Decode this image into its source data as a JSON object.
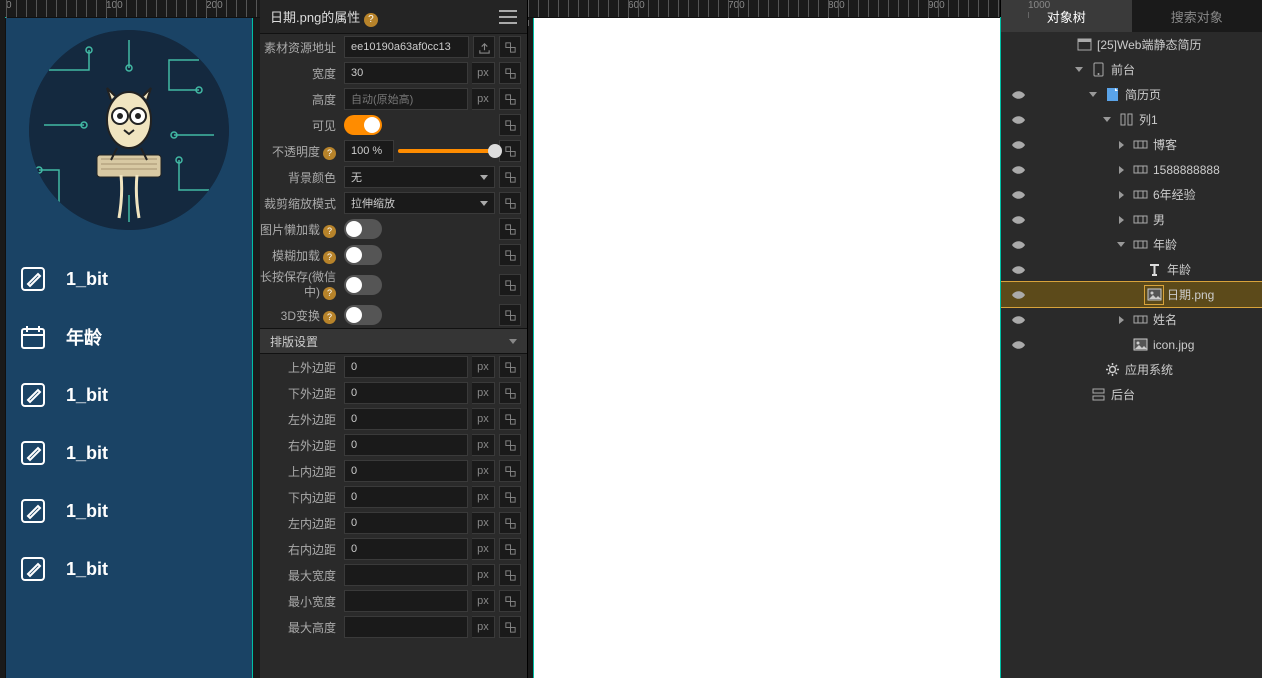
{
  "left_preview": {
    "items": [
      {
        "icon": "pencil",
        "label": "1_bit"
      },
      {
        "icon": "calendar",
        "label": "年龄"
      },
      {
        "icon": "pencil",
        "label": "1_bit"
      },
      {
        "icon": "pencil",
        "label": "1_bit"
      },
      {
        "icon": "pencil",
        "label": "1_bit"
      },
      {
        "icon": "pencil",
        "label": "1_bit"
      }
    ]
  },
  "prop_panel": {
    "title": "日期.png的属性",
    "fields": {
      "asset_url_label": "素材资源地址",
      "asset_url_value": "ee10190a63af0cc13",
      "width_label": "宽度",
      "width_value": "30",
      "px": "px",
      "height_label": "高度",
      "height_value": "自动(原始高)",
      "visible_label": "可见",
      "opacity_label": "不透明度",
      "opacity_value": "100 %",
      "opacity_pct": 100,
      "bgcolor_label": "背景颜色",
      "bgcolor_value": "无",
      "scale_label": "裁剪缩放模式",
      "scale_value": "拉伸缩放",
      "lazy_label": "图片懒加载",
      "blur_label": "模糊加载",
      "longpress_label": "长按保存(微信中)",
      "threed_label": "3D变换"
    },
    "layout_section": "排版设置",
    "layout": [
      {
        "k": "上外边距",
        "v": "0"
      },
      {
        "k": "下外边距",
        "v": "0"
      },
      {
        "k": "左外边距",
        "v": "0"
      },
      {
        "k": "右外边距",
        "v": "0"
      },
      {
        "k": "上内边距",
        "v": "0"
      },
      {
        "k": "下内边距",
        "v": "0"
      },
      {
        "k": "左内边距",
        "v": "0"
      },
      {
        "k": "右内边距",
        "v": "0"
      },
      {
        "k": "最大宽度",
        "v": ""
      },
      {
        "k": "最小宽度",
        "v": ""
      },
      {
        "k": "最大高度",
        "v": ""
      }
    ]
  },
  "ruler_left": [
    "0",
    "100",
    "200"
  ],
  "ruler_mid": [
    "",
    "600",
    "700",
    "800",
    "900",
    "1000"
  ],
  "obj_panel": {
    "tabs": {
      "tree": "对象树",
      "search": "搜索对象"
    },
    "nodes": [
      {
        "depth": 0,
        "vis": false,
        "arrow": "",
        "icon": "app",
        "label": "[25]Web端静态简历"
      },
      {
        "depth": 1,
        "vis": false,
        "arrow": "open",
        "icon": "phone",
        "label": "前台"
      },
      {
        "depth": 2,
        "vis": true,
        "arrow": "open",
        "icon": "page",
        "label": "简历页"
      },
      {
        "depth": 3,
        "vis": true,
        "arrow": "open",
        "icon": "col",
        "label": "列1"
      },
      {
        "depth": 4,
        "vis": true,
        "arrow": "closed",
        "icon": "row",
        "label": "博客"
      },
      {
        "depth": 4,
        "vis": true,
        "arrow": "closed",
        "icon": "row",
        "label": "1588888888"
      },
      {
        "depth": 4,
        "vis": true,
        "arrow": "closed",
        "icon": "row",
        "label": "6年经验"
      },
      {
        "depth": 4,
        "vis": true,
        "arrow": "closed",
        "icon": "row",
        "label": "男"
      },
      {
        "depth": 4,
        "vis": true,
        "arrow": "open",
        "icon": "row",
        "label": "年龄"
      },
      {
        "depth": 5,
        "vis": true,
        "arrow": "",
        "icon": "text",
        "label": "年龄"
      },
      {
        "depth": 5,
        "vis": true,
        "arrow": "",
        "icon": "img",
        "label": "日期.png",
        "sel": true
      },
      {
        "depth": 4,
        "vis": true,
        "arrow": "closed",
        "icon": "row",
        "label": "姓名"
      },
      {
        "depth": 4,
        "vis": true,
        "arrow": "",
        "icon": "img",
        "label": "icon.jpg"
      },
      {
        "depth": 2,
        "vis": false,
        "arrow": "",
        "icon": "gear",
        "label": "应用系统"
      },
      {
        "depth": 1,
        "vis": false,
        "arrow": "",
        "icon": "server",
        "label": "后台"
      }
    ]
  }
}
